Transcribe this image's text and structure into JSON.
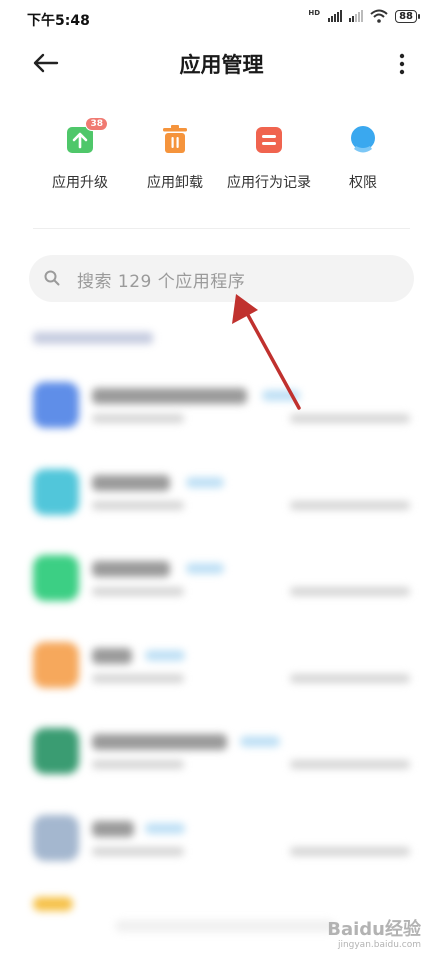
{
  "status_bar": {
    "time": "下午5:48",
    "network_label": "HD",
    "battery": "88"
  },
  "header": {
    "title": "应用管理",
    "back_icon": "arrow-left-icon",
    "more_icon": "more-vertical-icon"
  },
  "quick_actions": [
    {
      "label": "应用升级",
      "icon": "upgrade-arrow-icon",
      "color": "#4fc76a",
      "badge": "38"
    },
    {
      "label": "应用卸载",
      "icon": "trash-icon",
      "color": "#f5943c"
    },
    {
      "label": "应用行为记录",
      "icon": "record-icon",
      "color": "#f0644f"
    },
    {
      "label": "权限",
      "icon": "shield-person-icon",
      "color": "#3aa8ef"
    }
  ],
  "search": {
    "placeholder": "搜索 129 个应用程序"
  },
  "app_list": {
    "note": "",
    "icon_colors": [
      "#5f8ee8",
      "#51c6da",
      "#3ccf84",
      "#f6a85c",
      "#3a9c72",
      "#a4b7cf",
      "#f6c24a"
    ]
  },
  "annotation": {
    "arrow_color": "#c0312e"
  },
  "watermark": {
    "main": "Baidu经验",
    "sub": "jingyan.baidu.com"
  }
}
